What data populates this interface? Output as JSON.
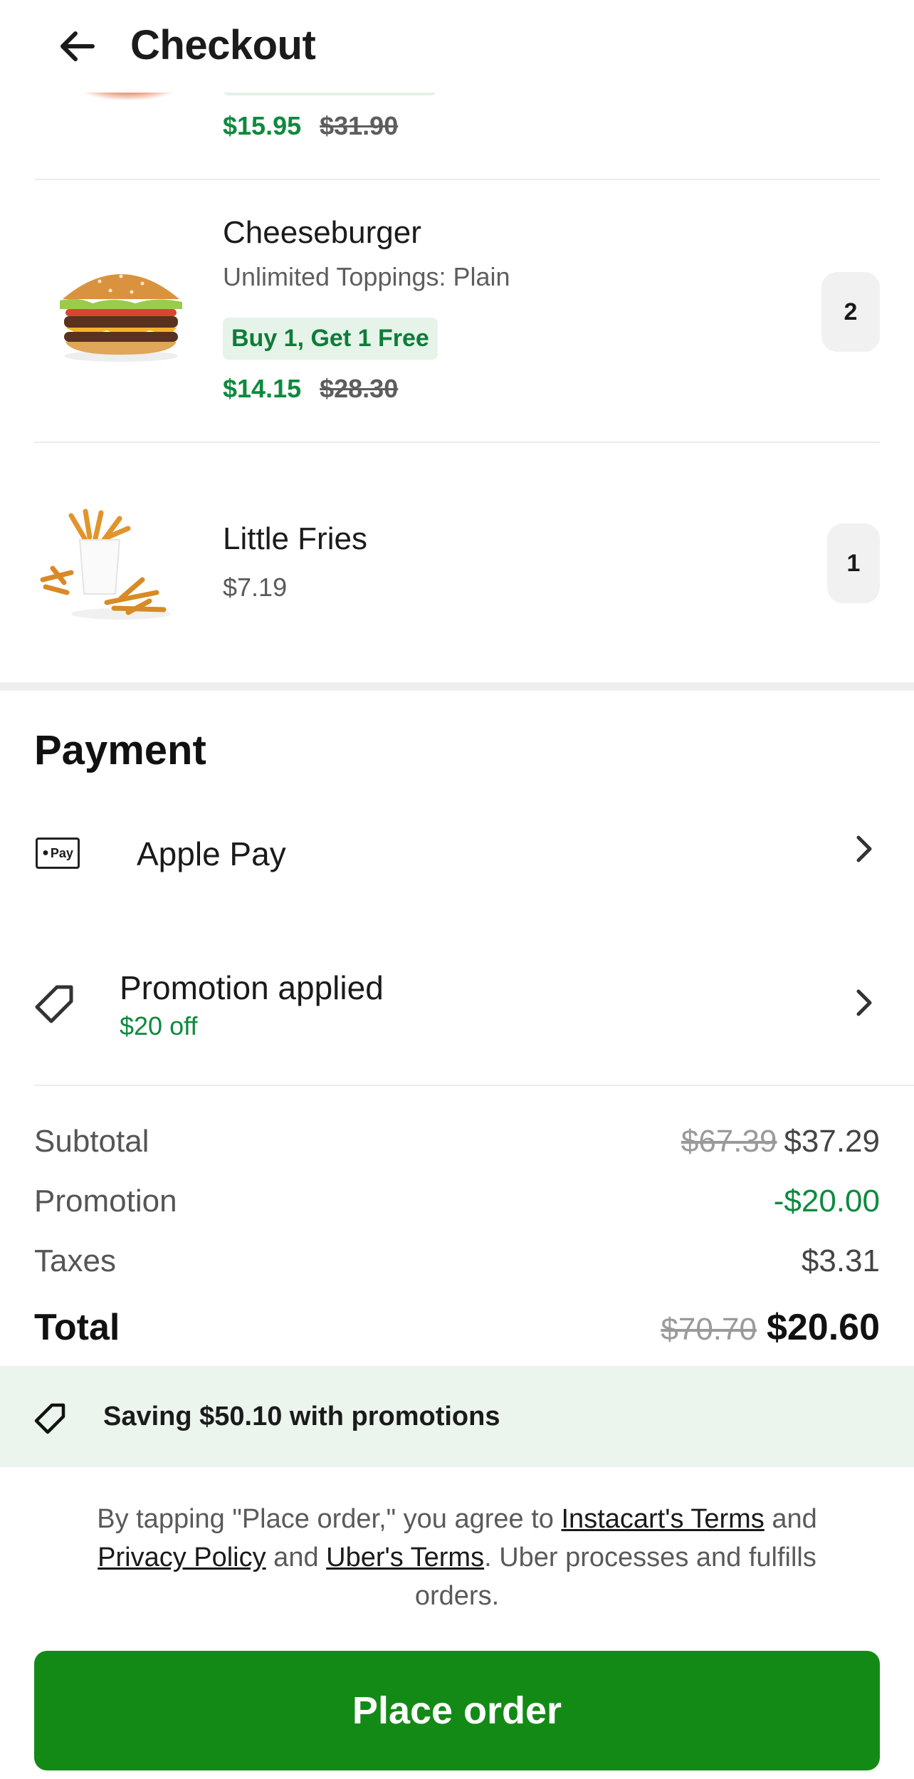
{
  "header": {
    "title": "Checkout"
  },
  "items": [
    {
      "price": "$15.95",
      "original_price": "$31.90"
    },
    {
      "name": "Cheeseburger",
      "option": "Unlimited Toppings: Plain",
      "badge": "Buy 1, Get 1 Free",
      "price": "$14.15",
      "original_price": "$28.30",
      "quantity": "2"
    },
    {
      "name": "Little Fries",
      "price": "$7.19",
      "quantity": "1"
    }
  ],
  "payment": {
    "title": "Payment",
    "method_icon_text": "Pay",
    "method": "Apple Pay",
    "promotion_label": "Promotion applied",
    "promotion_detail": "$20 off"
  },
  "summary": {
    "subtotal_label": "Subtotal",
    "subtotal_original": "$67.39",
    "subtotal": "$37.29",
    "promotion_label": "Promotion",
    "promotion": "-$20.00",
    "taxes_label": "Taxes",
    "taxes": "$3.31",
    "total_label": "Total",
    "total_original": "$70.70",
    "total": "$20.60"
  },
  "saving_banner": "Saving $50.10 with promotions",
  "legal": {
    "part1": "By tapping \"Place order,\" you agree to ",
    "link1": "Instacart's Terms",
    "part2": " and ",
    "link2": "Privacy Policy",
    "part3": " and ",
    "link3": "Uber's Terms",
    "part4": ". Uber processes and fulfills orders."
  },
  "place_order": "Place order",
  "colors": {
    "green_accent": "#0e8a3e",
    "button_green": "#138a16",
    "banner_bg": "#ecf4ee"
  },
  "icons": [
    "back-arrow-icon",
    "apple-pay-icon",
    "chevron-right-icon",
    "tag-icon"
  ]
}
